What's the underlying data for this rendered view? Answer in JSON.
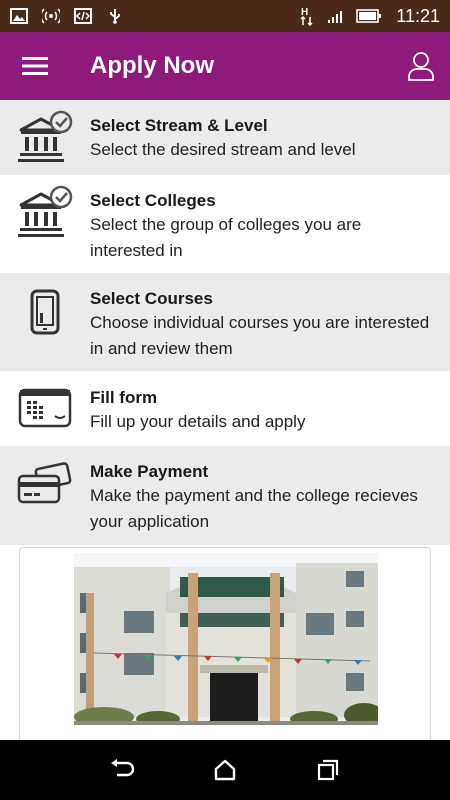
{
  "status_bar": {
    "time": "11:21"
  },
  "app_bar": {
    "title": "Apply Now"
  },
  "steps": [
    {
      "title": "Select Stream & Level",
      "desc": "Select the desired stream and level",
      "icon": "bank-check-icon"
    },
    {
      "title": "Select Colleges",
      "desc": "Select the group of colleges you are interested in",
      "icon": "bank-check-icon"
    },
    {
      "title": "Select Courses",
      "desc": "Choose individual courses you are interested in and review them",
      "icon": "phone-icon"
    },
    {
      "title": "Fill form",
      "desc": "Fill up your details and apply",
      "icon": "browser-form-icon"
    },
    {
      "title": "Make Payment",
      "desc": "Make the payment and the college recieves your application",
      "icon": "cards-icon"
    }
  ],
  "colors": {
    "app_bar": "#8e1b7b",
    "status_bar": "#4a2a1a",
    "shaded_row": "#ebebeb",
    "nav_bar": "#000000"
  }
}
